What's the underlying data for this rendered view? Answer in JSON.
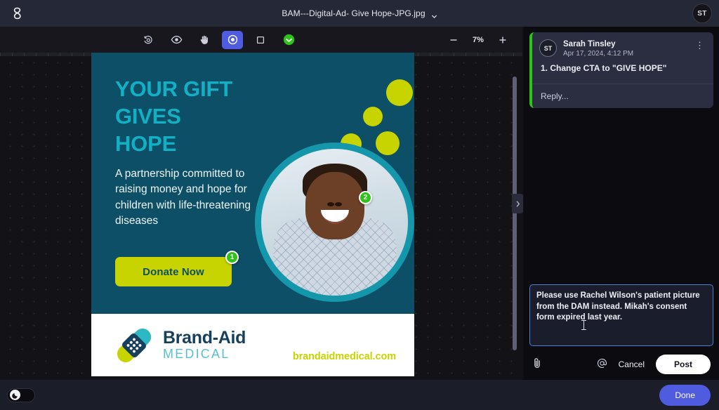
{
  "app": {
    "logo_icon": "infinity-logo-icon",
    "title": "BAM---Digital-Ad- Give Hope-JPG.jpg",
    "title_caret_icon": "chevron-down-icon",
    "user_avatar_initials": "ST"
  },
  "toolbar": {
    "tools": [
      {
        "name": "history-icon",
        "label": "Version history",
        "active": false
      },
      {
        "name": "eye-icon",
        "label": "Preview",
        "active": false
      },
      {
        "name": "hand-icon",
        "label": "Pan",
        "active": false
      },
      {
        "name": "annotation-point-icon",
        "label": "Point annotation",
        "active": true
      },
      {
        "name": "rectangle-icon",
        "label": "Rectangle annotation",
        "active": false
      },
      {
        "name": "approve-icon",
        "label": "Approve",
        "active": false
      }
    ],
    "zoom_out_icon": "minus-icon",
    "zoom_in_icon": "plus-icon",
    "zoom_level": "7%"
  },
  "canvas": {
    "collapse_icon": "chevron-right-icon"
  },
  "creative": {
    "headline": "YOUR GIFT\nGIVES\nHOPE",
    "headline_lines": [
      "YOUR GIFT",
      "GIVES",
      "HOPE"
    ],
    "body": "A partnership committed to raising money and hope for children with life-threatening diseases",
    "cta_label": "Donate Now",
    "pins": [
      {
        "number": "1",
        "target": "cta-button"
      },
      {
        "number": "2",
        "target": "photo"
      }
    ],
    "logo_brand": "Brand-Aid",
    "logo_sub": "MEDICAL",
    "website": "brandaidmedical.com",
    "colors": {
      "background": "#0d4f66",
      "headline": "#12b0c4",
      "accent_lime": "#c8d400",
      "accent_teal": "#1497aa",
      "logo_navy": "#17405e",
      "pin_green": "#2ec417"
    }
  },
  "comments": {
    "thread": [
      {
        "avatar_initials": "ST",
        "author": "Sarah Tinsley",
        "timestamp": "Apr 17, 2024, 4:12 PM",
        "body": "1. Change CTA to \"GIVE HOPE\"",
        "menu_icon": "kebab-menu-icon"
      }
    ],
    "reply_placeholder": "Reply..."
  },
  "composer": {
    "value": "Please use Rachel Wilson's patient picture from the DAM instead. Mikah's consent form expired last year.",
    "attach_icon": "paperclip-icon",
    "mention_icon": "at-mention-icon",
    "cancel_label": "Cancel",
    "post_label": "Post"
  },
  "bottombar": {
    "theme_toggle_icon": "moon-icon",
    "done_label": "Done"
  }
}
